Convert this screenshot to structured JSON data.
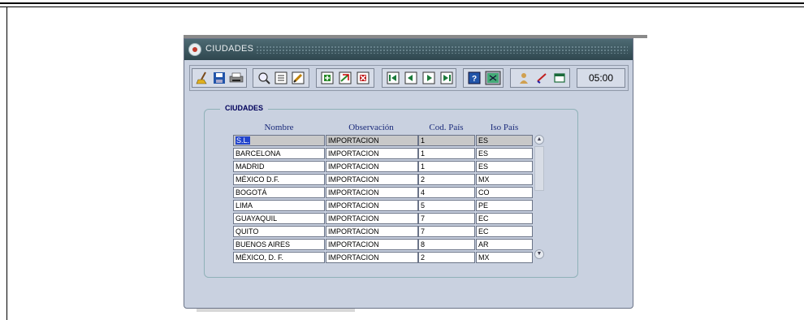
{
  "window": {
    "title": "CIUDADES"
  },
  "toolbar": {
    "icons": [
      "broom-icon",
      "save-icon",
      "printer-icon",
      "search-icon",
      "list-icon",
      "edit-icon",
      "insert-record-icon",
      "duplicate-record-icon",
      "delete-record-icon",
      "first-record-icon",
      "previous-record-icon",
      "next-record-icon",
      "last-record-icon",
      "help-icon",
      "exit-icon",
      "user-icon",
      "check-icon",
      "window-icon"
    ],
    "clock": "05:00"
  },
  "section": {
    "label": "CIUDADES"
  },
  "columns": {
    "nombre": "Nombre",
    "observacion": "Observación",
    "cod_pais": "Cod. País",
    "iso_pais": "Iso País"
  },
  "rows": [
    {
      "nombre": "S.L.",
      "observacion": "IMPORTACION",
      "cod_pais": "1",
      "iso_pais": "ES"
    },
    {
      "nombre": "BARCELONA",
      "observacion": "IMPORTACION",
      "cod_pais": "1",
      "iso_pais": "ES"
    },
    {
      "nombre": "MADRID",
      "observacion": "IMPORTACION",
      "cod_pais": "1",
      "iso_pais": "ES"
    },
    {
      "nombre": "MÉXICO D.F.",
      "observacion": "IMPORTACION",
      "cod_pais": "2",
      "iso_pais": "MX"
    },
    {
      "nombre": "BOGOTÁ",
      "observacion": "IMPORTACION",
      "cod_pais": "4",
      "iso_pais": "CO"
    },
    {
      "nombre": "LIMA",
      "observacion": "IMPORTACION",
      "cod_pais": "5",
      "iso_pais": "PE"
    },
    {
      "nombre": "GUAYAQUIL",
      "observacion": "IMPORTACION",
      "cod_pais": "7",
      "iso_pais": "EC"
    },
    {
      "nombre": "QUITO",
      "observacion": "IMPORTACION",
      "cod_pais": "7",
      "iso_pais": "EC"
    },
    {
      "nombre": "BUENOS AIRES",
      "observacion": "IMPORTACION",
      "cod_pais": "8",
      "iso_pais": "AR"
    },
    {
      "nombre": "MÉXICO, D. F.",
      "observacion": "IMPORTACION",
      "cod_pais": "2",
      "iso_pais": "MX"
    }
  ],
  "colors": {
    "titlebar": "#2f474f",
    "window_bg": "#c9d1e0",
    "selection": "#2244cc",
    "header_text": "#1a2a7a"
  }
}
